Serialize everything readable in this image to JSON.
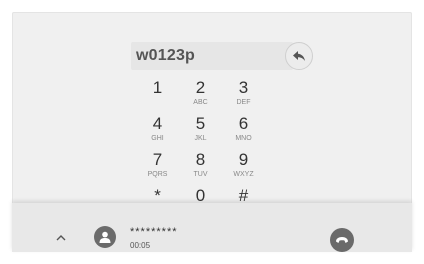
{
  "dialer": {
    "entered_number": "w0123p"
  },
  "keypad": {
    "keys": [
      {
        "digit": "1",
        "letters": ""
      },
      {
        "digit": "2",
        "letters": "ABC"
      },
      {
        "digit": "3",
        "letters": "DEF"
      },
      {
        "digit": "4",
        "letters": "GHI"
      },
      {
        "digit": "5",
        "letters": "JKL"
      },
      {
        "digit": "6",
        "letters": "MNO"
      },
      {
        "digit": "7",
        "letters": "PQRS"
      },
      {
        "digit": "8",
        "letters": "TUV"
      },
      {
        "digit": "9",
        "letters": "WXYZ"
      },
      {
        "digit": "*",
        "letters": ""
      },
      {
        "digit": "0",
        "letters": "+"
      },
      {
        "digit": "#",
        "letters": ""
      }
    ]
  },
  "call_bar": {
    "caller_name": "*********",
    "call_duration": "00:05"
  },
  "icons": {
    "backspace": "backspace-arrow-icon",
    "expand": "chevron-up-icon",
    "avatar": "person-icon",
    "end_call": "hang-up-icon"
  }
}
